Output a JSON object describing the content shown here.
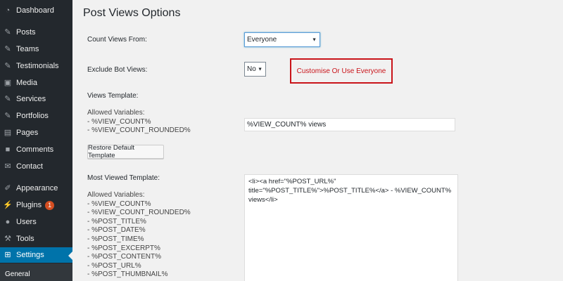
{
  "sidebar": {
    "items": [
      {
        "label": "Dashboard",
        "icon": "dashboard-icon"
      },
      {
        "label": "Posts",
        "icon": "pin-icon"
      },
      {
        "label": "Teams",
        "icon": "pin-icon"
      },
      {
        "label": "Testimonials",
        "icon": "pin-icon"
      },
      {
        "label": "Media",
        "icon": "media-icon"
      },
      {
        "label": "Services",
        "icon": "pin-icon"
      },
      {
        "label": "Portfolios",
        "icon": "pin-icon"
      },
      {
        "label": "Pages",
        "icon": "pages-icon"
      },
      {
        "label": "Comments",
        "icon": "comment-icon"
      },
      {
        "label": "Contact",
        "icon": "mail-icon"
      },
      {
        "label": "Appearance",
        "icon": "brush-icon"
      },
      {
        "label": "Plugins",
        "icon": "plug-icon",
        "badge": "1"
      },
      {
        "label": "Users",
        "icon": "user-icon"
      },
      {
        "label": "Tools",
        "icon": "wrench-icon"
      },
      {
        "label": "Settings",
        "icon": "settings-icon",
        "active": true
      }
    ],
    "submenu": {
      "label": "General"
    }
  },
  "main": {
    "title": "Post Views Options",
    "count_views_from": {
      "label": "Count Views From:",
      "value": "Everyone"
    },
    "exclude_bot_views": {
      "label": "Exclude Bot Views:",
      "value": "No"
    },
    "callout": "Customise Or Use Everyone",
    "views_template": {
      "label": "Views Template:",
      "allowed_variables": "Allowed Variables:\n- %VIEW_COUNT%\n- %VIEW_COUNT_ROUNDED%",
      "value": "%VIEW_COUNT% views",
      "restore_button": "Restore Default Template"
    },
    "most_viewed_template": {
      "label": "Most Viewed Template:",
      "allowed_variables": "Allowed Variables:\n- %VIEW_COUNT%\n- %VIEW_COUNT_ROUNDED%\n- %POST_TITLE%\n- %POST_DATE%\n- %POST_TIME%\n- %POST_EXCERPT%\n- %POST_CONTENT%\n- %POST_URL%\n- %POST_THUMBNAIL%",
      "value": "<li><a href=\"%POST_URL%\" title=\"%POST_TITLE%\">%POST_TITLE%</a> - %VIEW_COUNT% views</li>"
    }
  },
  "colors": {
    "sidebar_bg": "#23282d",
    "active": "#0073aa",
    "callout": "#c9141a",
    "badge": "#d54e21"
  }
}
